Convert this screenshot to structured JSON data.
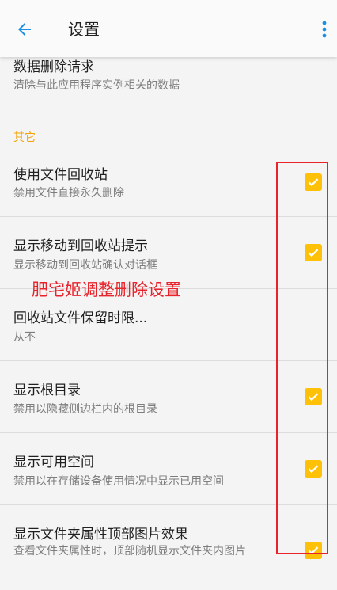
{
  "appbar": {
    "title": "设置",
    "back_icon": "arrow-left-icon",
    "more_icon": "more-vert-icon",
    "accent_color": "#1a8fe3"
  },
  "top_pref": {
    "title": "数据删除请求",
    "summary": "清除与此应用程序实例相关的数据"
  },
  "category": {
    "label": "其它",
    "color": "#f2a100"
  },
  "prefs": [
    {
      "title": "使用文件回收站",
      "summary": "禁用文件直接永久删除",
      "checked": true
    },
    {
      "title": "显示移动到回收站提示",
      "summary": "显示移动到回收站确认对话框",
      "checked": true
    },
    {
      "title": "回收站文件保留时限...",
      "summary": "从不"
    },
    {
      "title": "显示根目录",
      "summary": "禁用以隐藏侧边栏内的根目录",
      "checked": true
    },
    {
      "title": "显示可用空间",
      "summary": "禁用以在存储设备使用情况中显示已用空间",
      "checked": true
    },
    {
      "title": "显示文件夹属性顶部图片效果",
      "summary": "查看文件夹属性时，顶部随机显示文件夹内图片",
      "checked": true
    }
  ],
  "annotation": {
    "text": "肥宅姬调整删除设置",
    "color": "#e8232b"
  },
  "checkbox_color": "#ffc107"
}
